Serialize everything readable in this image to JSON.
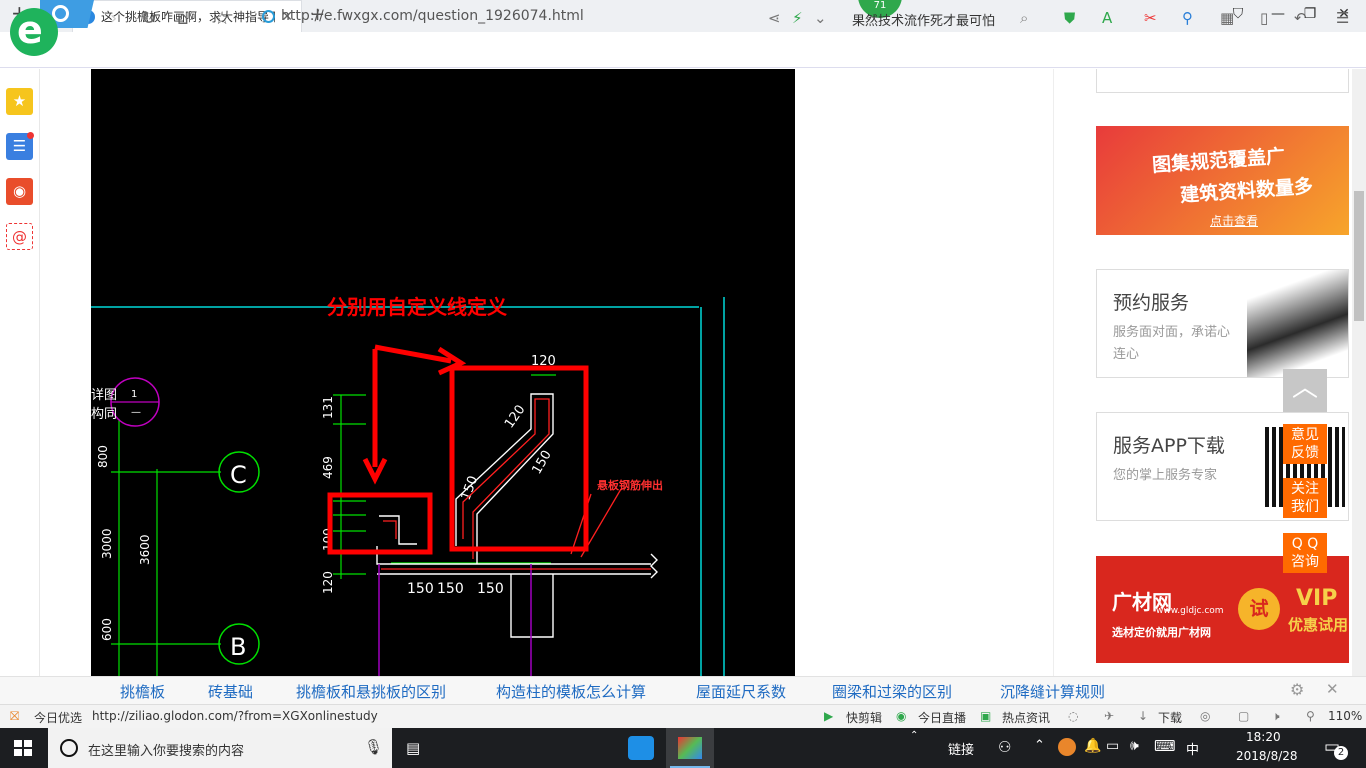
{
  "browser": {
    "tab_title": "这个挑檐板咋画啊，求大神指导下",
    "tab_close": "✕",
    "new_tab": "+",
    "badge": "71",
    "address": "http://e.fwxgx.com/question_1926074.html",
    "search_hint": "果然技术流作死才最可怕"
  },
  "cad": {
    "annotation": "分别用自定义线定义",
    "dims": [
      "120",
      "120",
      "150",
      "150",
      "150",
      "150",
      "150",
      "150",
      "131",
      "469",
      "100",
      "120",
      "800",
      "3000",
      "3600",
      "600"
    ],
    "label_right": "悬板钢筋伸出",
    "axis_c": "C",
    "axis_b": "B",
    "detail_top": "1",
    "detail_bottom": "—",
    "left_text1": "详图",
    "left_text2": "构同"
  },
  "right": {
    "ad1_line1": "图集规范覆盖广",
    "ad1_line2": "建筑资料数量多",
    "ad1_link": "点击查看",
    "card1_title": "预约服务",
    "card1_sub": "服务面对面，承诺心连心",
    "card2_title": "服务APP下载",
    "card2_sub": "您的掌上服务专家",
    "ad2_logo": "广材网",
    "ad2_url": "www.gldjc.com",
    "ad2_slogan": "选材定价就用广材网",
    "ad2_try": "试",
    "ad2_vip": "VIP",
    "ad2_vip_sub": "优惠试用",
    "float_feedback": "意见\n反馈",
    "float_follow": "关注\n我们",
    "float_qq": "Q Q\n咨询"
  },
  "tags": [
    "挑檐板",
    "砖基础",
    "挑檐板和悬挑板的区别",
    "构造柱的模板怎么计算",
    "屋面延尺系数",
    "圈梁和过梁的区别",
    "沉降缝计算规则"
  ],
  "status": {
    "today": "今日优选",
    "url": "http://ziliao.glodon.com/?from=XGXonlinestudy",
    "items": [
      "快剪辑",
      "今日直播",
      "热点资讯",
      "下载"
    ],
    "zoom": "110%"
  },
  "taskbar": {
    "search_placeholder": "在这里输入你要搜索的内容",
    "link": "链接",
    "ime": "中",
    "time": "18:20",
    "date": "2018/8/28",
    "notif_count": "2"
  },
  "colors": {
    "cad_bg": "#000000",
    "cad_red": "#ff0000",
    "cad_green": "#00ff00",
    "cad_cyan": "#00ffff",
    "tag_accent": "#3e9de3",
    "float_orange": "#ff6a00"
  }
}
